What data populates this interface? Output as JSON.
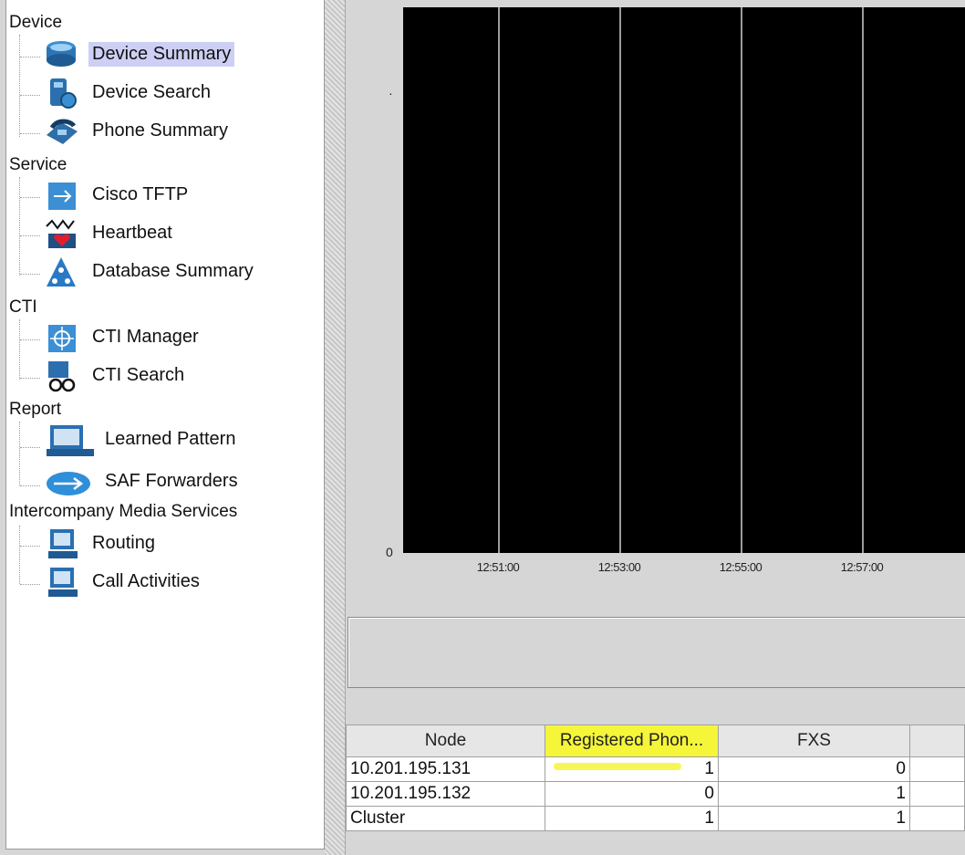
{
  "tree": {
    "categories": {
      "device": "Device",
      "service": "Service",
      "cti": "CTI",
      "report": "Report",
      "ims": "Intercompany Media Services"
    },
    "items": {
      "device_summary": "Device Summary",
      "device_search": "Device Search",
      "phone_summary": "Phone Summary",
      "cisco_tftp": "Cisco TFTP",
      "heartbeat": "Heartbeat",
      "database_summary": "Database Summary",
      "cti_manager": "CTI Manager",
      "cti_search": "CTI Search",
      "learned_pattern": "Learned Pattern",
      "saf_forwarders": "SAF Forwarders",
      "routing": "Routing",
      "call_activities": "Call Activities"
    },
    "selected": "Device Summary"
  },
  "chart_data": {
    "type": "line",
    "y_ticks": [
      "0"
    ],
    "x_ticks": [
      "12:51:00",
      "12:53:00",
      "12:55:00",
      "12:57:00"
    ],
    "background": "#000000",
    "grid": true,
    "series": []
  },
  "table": {
    "columns": [
      "Node",
      "Registered Phon...",
      "FXS"
    ],
    "rows": [
      [
        "10.201.195.131",
        "1",
        "0"
      ],
      [
        "10.201.195.132",
        "0",
        "1"
      ],
      [
        "Cluster",
        "1",
        "1"
      ]
    ],
    "highlight_color": "#f5f53a"
  }
}
